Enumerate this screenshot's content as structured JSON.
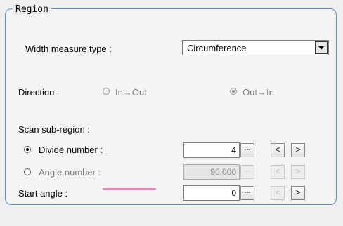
{
  "legend": "Region",
  "width_measure_type": {
    "label": "Width measure type :",
    "value": "Circumference"
  },
  "direction": {
    "label": "Direction :",
    "option_in_out": "In→Out",
    "option_out_in": "Out→In",
    "selected": "Out→In"
  },
  "scan": {
    "label": "Scan sub-region :"
  },
  "divide": {
    "label": "Divide number :",
    "value": "4",
    "selected": true
  },
  "angle_number": {
    "label": "Angle number :",
    "value": "90.000",
    "selected": false
  },
  "start_angle": {
    "label": "Start angle :",
    "value": "0"
  },
  "buttons": {
    "ellipsis": "...",
    "prev": "<",
    "next": ">"
  },
  "colors": {
    "frame": "#5a8fc7",
    "underline": "#e887b8"
  }
}
